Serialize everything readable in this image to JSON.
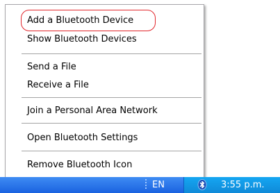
{
  "menu": {
    "add_device": "Add a Bluetooth Device",
    "show_devices": "Show Bluetooth Devices",
    "send_file": "Send a File",
    "receive_file": "Receive a File",
    "join_network": "Join a Personal Area Network",
    "open_settings": "Open Bluetooth Settings",
    "remove_icon": "Remove Bluetooth Icon"
  },
  "taskbar": {
    "language": "EN",
    "clock": "3:55 p.m."
  },
  "icons": {
    "tray_icon": "bluetooth-icon"
  },
  "colors": {
    "highlight": "#e2262c",
    "taskbar": "#1a62e0",
    "tray": "#0f8ad8"
  }
}
